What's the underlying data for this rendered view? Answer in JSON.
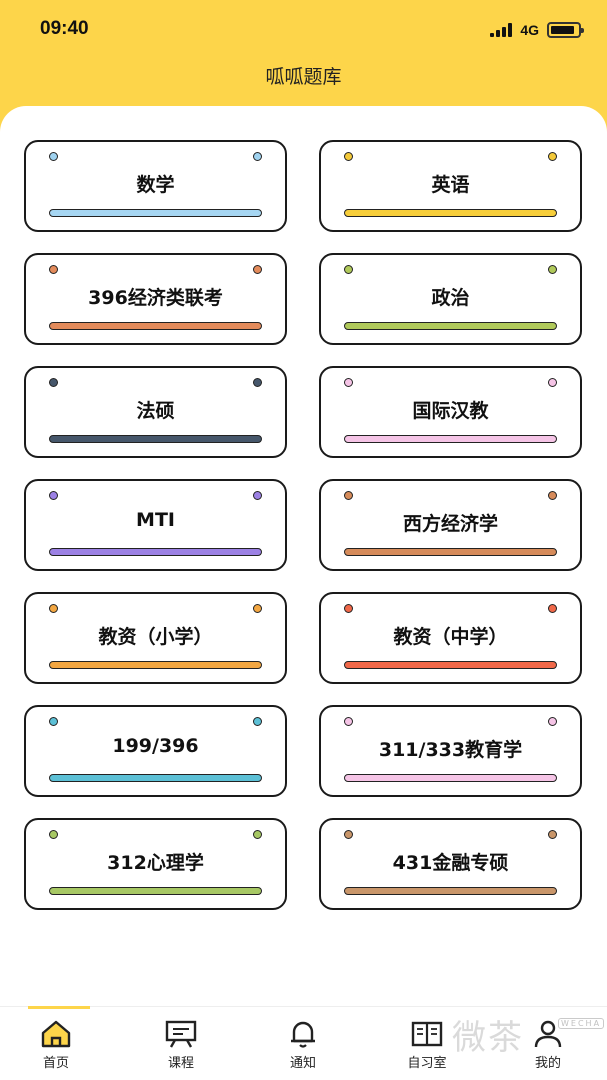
{
  "status_bar": {
    "time": "09:40",
    "network": "4G"
  },
  "header": {
    "title": "呱呱题库"
  },
  "subjects": [
    {
      "label": "数学",
      "color": "#a6d6f2",
      "dot": "#9fd2ef"
    },
    {
      "label": "英语",
      "color": "#f7ce3a",
      "dot": "#f3c93a"
    },
    {
      "label": "396经济类联考",
      "color": "#e38b5b",
      "dot": "#e38b5b"
    },
    {
      "label": "政治",
      "color": "#b0c95a",
      "dot": "#b0c95a"
    },
    {
      "label": "法硕",
      "color": "#46576b",
      "dot": "#46576b"
    },
    {
      "label": "国际汉教",
      "color": "#f5c4e6",
      "dot": "#f5c4e6"
    },
    {
      "label": "MTI",
      "color": "#9c81e4",
      "dot": "#9c81e4"
    },
    {
      "label": "西方经济学",
      "color": "#d68b5a",
      "dot": "#d68b5a"
    },
    {
      "label": "教资（小学）",
      "color": "#f3a742",
      "dot": "#f3a742"
    },
    {
      "label": "教资（中学）",
      "color": "#f06849",
      "dot": "#f06849"
    },
    {
      "label": "199/396",
      "color": "#5cc0d6",
      "dot": "#5cc0d6"
    },
    {
      "label": "311/333教育学",
      "color": "#f5c4e6",
      "dot": "#f5c4e6"
    },
    {
      "label": "312心理学",
      "color": "#a7c864",
      "dot": "#a7c864"
    },
    {
      "label": "431金融专硕",
      "color": "#c9966a",
      "dot": "#c9966a"
    }
  ],
  "tabbar": [
    {
      "label": "首页",
      "icon": "home-icon",
      "active": true
    },
    {
      "label": "课程",
      "icon": "presentation-icon",
      "active": false
    },
    {
      "label": "通知",
      "icon": "bell-icon",
      "active": false
    },
    {
      "label": "自习室",
      "icon": "book-icon",
      "active": false
    },
    {
      "label": "我的",
      "icon": "user-icon",
      "active": false
    }
  ],
  "watermark": {
    "text": "微茶",
    "badge": "WECHA"
  },
  "colors": {
    "brand_yellow": "#fdd54a",
    "outline": "#1a1a1a"
  }
}
